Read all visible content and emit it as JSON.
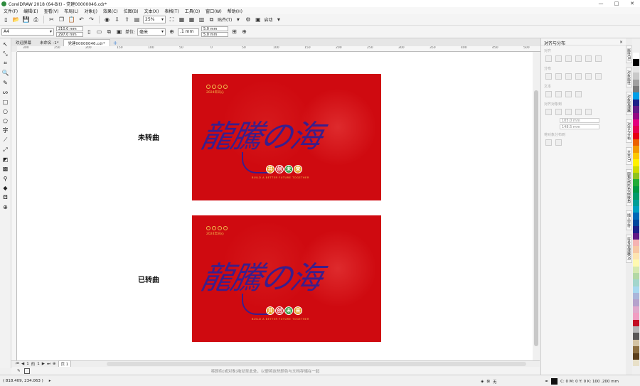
{
  "window": {
    "title": "CorelDRAW 2018 (64-Bit) - 党建00000046.cdr*"
  },
  "menu": [
    "文件(F)",
    "编辑(E)",
    "查看(V)",
    "布局(L)",
    "对象(J)",
    "效果(C)",
    "位图(B)",
    "文本(X)",
    "表格(T)",
    "工具(O)",
    "窗口(W)",
    "帮助(H)"
  ],
  "toolbar": {
    "zoom": "25%",
    "snap_label": "贴齐(T)",
    "launch_label": "启动"
  },
  "propertybar": {
    "page_size": "A4",
    "width": "210.0 mm",
    "height": "297.0 mm",
    "units_label": "单位:",
    "units_value": "毫米",
    "nudge": ".1 mm",
    "dup_x": "5.0 mm",
    "dup_y": "5.0 mm"
  },
  "tabs": [
    {
      "label": "欢迎屏幕"
    },
    {
      "label": "未命名 -1*"
    },
    {
      "label": "党建00000046.cdr*"
    }
  ],
  "ruler": {
    "ticks": [
      "300",
      "250",
      "200",
      "150",
      "100",
      "50",
      "0",
      "50",
      "100",
      "150",
      "200",
      "250",
      "300",
      "350",
      "400",
      "450",
      "500"
    ]
  },
  "artboards": [
    {
      "side_label": "未转曲",
      "title_text": "龍騰の海",
      "year_text": "2024年同心",
      "badges": [
        "共",
        "创",
        "未",
        "来"
      ],
      "slogan": "BUILD A BETTER FUTURE TOGETHER"
    },
    {
      "side_label": "已转曲",
      "title_text": "龍騰の海",
      "year_text": "2024年同心",
      "badges": [
        "共",
        "创",
        "未",
        "来"
      ],
      "slogan": "BUILD A BETTER FUTURE TOGETHER"
    }
  ],
  "page_nav": {
    "current": "1",
    "of": "的",
    "total": "1",
    "page_tab": "页 1"
  },
  "colorbar": {
    "hint": "将颜色(或对象)拖动至此处，以便将这些颜色与文档存储在一起"
  },
  "status": {
    "coords": "( 818.409, 234.063 )",
    "fill_label": "无",
    "outline_info": "C: 0 M: 0 Y: 0 K: 100  .200 mm"
  },
  "docker": {
    "title": "对齐与分布",
    "section_align": "对齐",
    "section_distribute": "分布",
    "section_text": "文本",
    "section_align_objects": "对齐对象到",
    "section_distribute_to": "将对象分布到",
    "x_value": "105.0 mm",
    "y_value": "148.5 mm"
  },
  "vtabs": [
    "属性(R)",
    "对象属性",
    "对象管理器",
    "对齐与分布",
    "文本(T)",
    "圆角/扇形角/倒棱角",
    "插入字符",
    "符号管理器(X)"
  ],
  "palette": [
    "#ffffff",
    "#000000",
    "#e5e5e5",
    "#c9c9c9",
    "#a0a0a0",
    "#7a7a7a",
    "#00a0e9",
    "#1d2088",
    "#601986",
    "#920783",
    "#e4007f",
    "#e5004f",
    "#e60012",
    "#eb6100",
    "#f39800",
    "#fcc800",
    "#fff100",
    "#cfdb00",
    "#8fc31f",
    "#22ac38",
    "#009944",
    "#009b6b",
    "#009e96",
    "#00a0c1",
    "#0068b7",
    "#00479d",
    "#1d2088",
    "#601986",
    "#f5b2b2",
    "#f8c7a4",
    "#fde4b0",
    "#fff9b1",
    "#d6e9b0",
    "#b3d8a5",
    "#a3d6cc",
    "#a7d8ef",
    "#aab5da",
    "#b5a2cc",
    "#e1a9cc",
    "#f19ec2",
    "#c30d23",
    "#b5b5b6",
    "#595757",
    "#d3c3a3",
    "#8b6d3f",
    "#5a3e1b",
    "#e8e0c8"
  ]
}
